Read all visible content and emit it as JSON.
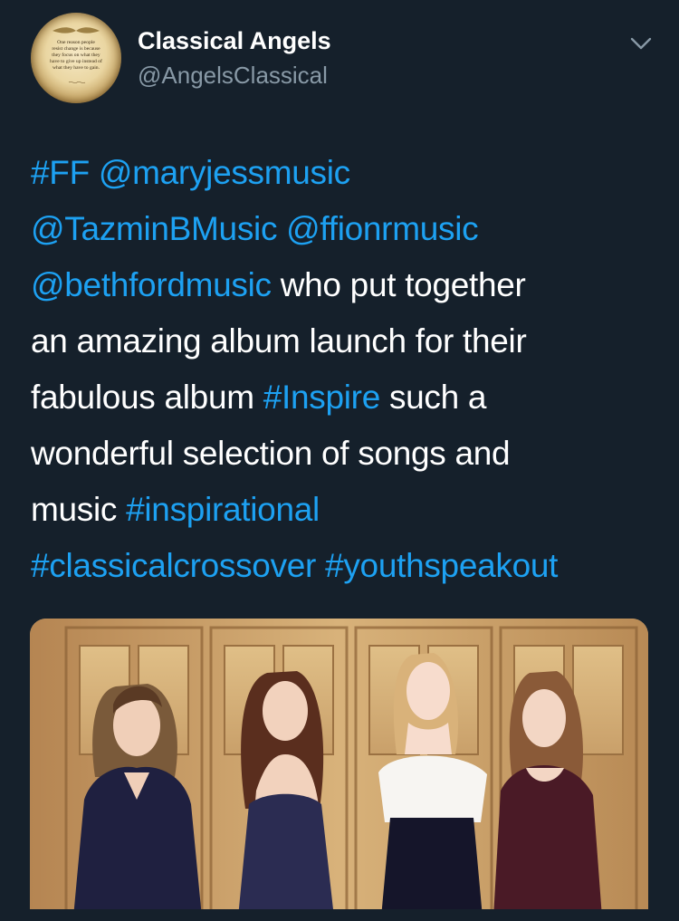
{
  "tweet": {
    "author": {
      "display_name": "Classical Angels",
      "handle": "@AngelsClassical",
      "avatar": {
        "quote_lines": [
          "One reason people",
          "resist change is because",
          "they focus on what they",
          "have to give up instead of",
          "what they have to gain."
        ]
      }
    },
    "menu_icon": "chevron-down-icon",
    "text_lines": [
      [
        {
          "t": "#FF",
          "link": true
        },
        {
          "t": " ",
          "link": false
        },
        {
          "t": "@maryjessmusic",
          "link": true
        }
      ],
      [
        {
          "t": "@TazminBMusic",
          "link": true
        },
        {
          "t": " ",
          "link": false
        },
        {
          "t": "@ffionrmusic",
          "link": true
        }
      ],
      [
        {
          "t": "@bethfordmusic",
          "link": true
        },
        {
          "t": " who put together",
          "link": false
        }
      ],
      [
        {
          "t": "an amazing album launch for their",
          "link": false
        }
      ],
      [
        {
          "t": "fabulous album ",
          "link": false
        },
        {
          "t": "#Inspire",
          "link": true
        },
        {
          "t": " such a",
          "link": false
        }
      ],
      [
        {
          "t": "wonderful selection of songs and",
          "link": false
        }
      ],
      [
        {
          "t": "music ",
          "link": false
        },
        {
          "t": "#inspirational",
          "link": true
        }
      ],
      [
        {
          "t": "#classicalcrossover",
          "link": true
        },
        {
          "t": " ",
          "link": false
        },
        {
          "t": "#youthspeakout",
          "link": true
        }
      ]
    ],
    "media": {
      "subject": "photo-four-women-in-evening-gowns"
    }
  },
  "colors": {
    "background": "#15202b",
    "text_primary": "#ffffff",
    "text_secondary": "#8899a6",
    "link": "#1da1f2"
  }
}
